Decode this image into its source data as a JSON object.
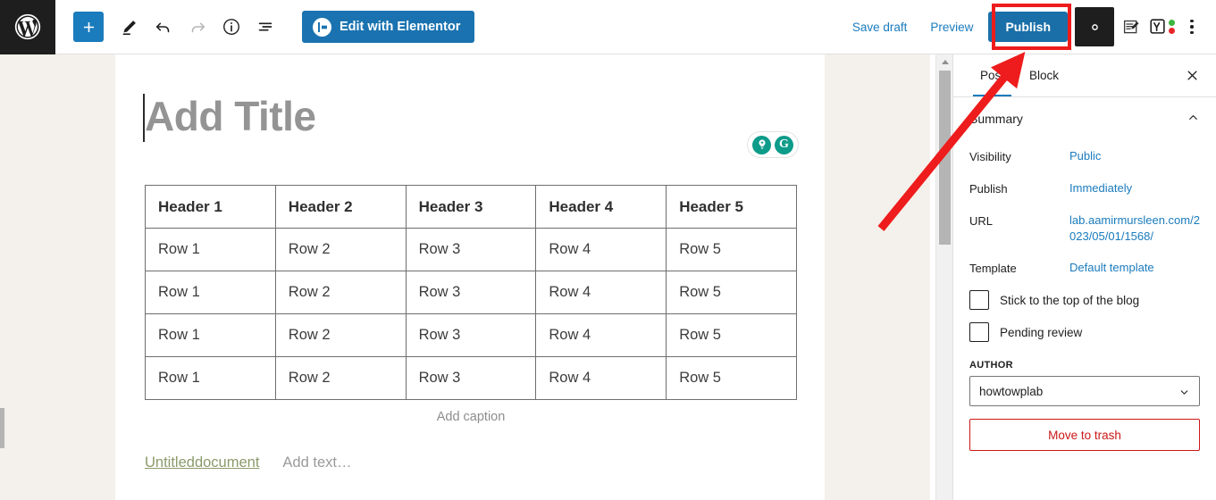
{
  "toolbar": {
    "logo_icon": "wordpress-logo-icon",
    "add_block_label": "+",
    "add_block_icon": "plus-icon",
    "tools": [
      {
        "name": "edit-tool",
        "icon": "pencil-icon",
        "disabled": false
      },
      {
        "name": "undo",
        "icon": "undo-arrow-icon",
        "disabled": false
      },
      {
        "name": "redo",
        "icon": "redo-arrow-icon",
        "disabled": true
      },
      {
        "name": "details",
        "icon": "info-circle-icon",
        "disabled": false
      },
      {
        "name": "list-view",
        "icon": "list-view-icon",
        "disabled": false
      }
    ],
    "elementor_label": "Edit with Elementor",
    "save_draft_label": "Save draft",
    "preview_label": "Preview",
    "publish_label": "Publish",
    "settings_icon": "gear-icon",
    "document_overview_icon": "document-pencil-icon",
    "yoast_icon": "yoast-seo-icon",
    "more_icon": "kebab-menu-icon",
    "yoast_dot_good": "#3db43d",
    "yoast_dot_bad": "#e8262a",
    "accent_blue": "#1a7bbd",
    "publish_blue": "#1a6fa8"
  },
  "editor": {
    "title_placeholder": "Add Title",
    "assistants": [
      {
        "name": "writing-assistant-bulb",
        "icon": "lightbulb-icon"
      },
      {
        "name": "grammarly",
        "icon": "grammarly-g-icon",
        "glyph": "G"
      }
    ],
    "table": {
      "headers": [
        "Header 1",
        "Header 2",
        "Header 3",
        "Header 4",
        "Header 5"
      ],
      "rows": [
        [
          "Row 1",
          "Row 2",
          "Row 3",
          "Row 4",
          "Row 5"
        ],
        [
          "Row 1",
          "Row 2",
          "Row 3",
          "Row 4",
          "Row 5"
        ],
        [
          "Row 1",
          "Row 2",
          "Row 3",
          "Row 4",
          "Row 5"
        ],
        [
          "Row 1",
          "Row 2",
          "Row 3",
          "Row 4",
          "Row 5"
        ]
      ],
      "caption_placeholder": "Add caption"
    },
    "paragraph": {
      "link_text": "Untitleddocument",
      "placeholder": "Add text…"
    }
  },
  "sidebar": {
    "tabs": [
      {
        "label": "Post",
        "active": true
      },
      {
        "label": "Block",
        "active": false
      }
    ],
    "close_icon": "close-icon",
    "section_title": "Summary",
    "collapse_icon": "chevron-up-icon",
    "rows": [
      {
        "label": "Visibility",
        "value": "Public"
      },
      {
        "label": "Publish",
        "value": "Immediately"
      },
      {
        "label": "URL",
        "value": "lab.aamirmursleen.com/2023/05/01/1568/"
      },
      {
        "label": "Template",
        "value": "Default template"
      }
    ],
    "checkboxes": [
      {
        "label": "Stick to the top of the blog",
        "checked": false
      },
      {
        "label": "Pending review",
        "checked": false
      }
    ],
    "author_label": "AUTHOR",
    "author_value": "howtowplab",
    "trash_label": "Move to trash",
    "trash_color": "#cc1818"
  },
  "annotations": {
    "highlight_color": "#ee1c1c",
    "box_target": "publish-button",
    "arrow_from": "sidebar",
    "arrow_to": "publish-button"
  }
}
